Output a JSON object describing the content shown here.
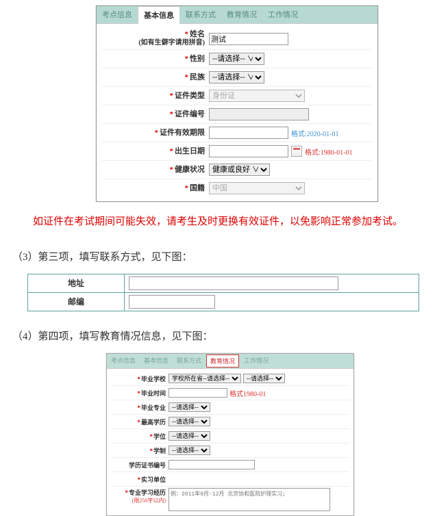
{
  "screenshot1": {
    "tabs": [
      "考点信息",
      "基本信息",
      "联系方式",
      "教育情况",
      "工作情况"
    ],
    "activeTabIndex": 1,
    "rows": {
      "name": {
        "label": "姓名",
        "sublabel": "(如有生僻字请用拼音)",
        "value": "测试"
      },
      "gender": {
        "label": "性别",
        "value": "--请选择-- ∨"
      },
      "ethnic": {
        "label": "民族",
        "value": "--请选择-- ∨"
      },
      "idtype": {
        "label": "证件类型",
        "value": "身份证"
      },
      "idnum": {
        "label": "证件编号",
        "value": ""
      },
      "idexp": {
        "label": "证件有效期限",
        "value": "",
        "hint": "格式:2020-01-01"
      },
      "birth": {
        "label": "出生日期",
        "value": "",
        "hint": "格式:1980-01-01"
      },
      "health": {
        "label": "健康状况",
        "value": "健康或良好 ∨"
      },
      "nation": {
        "label": "国籍",
        "value": "中国"
      }
    }
  },
  "warning": "　　如证件在考试期间可能失效，请考生及时更换有效证件，以免影响正常参加考试。",
  "step3": "（3）第三项，填写联系方式，见下图：",
  "screenshot2": {
    "rows": {
      "addr": {
        "label": "地址",
        "value": ""
      },
      "zip": {
        "label": "邮编",
        "value": ""
      }
    }
  },
  "step4": "（4）第四项，填写教育情况信息，见下图：",
  "screenshot3": {
    "tabs": [
      "考点信息",
      "基本信息",
      "联系方式",
      "教育情况",
      "工作情况"
    ],
    "activeTabIndex": 3,
    "rows": {
      "school": {
        "label": "毕业学校",
        "value1": "学校所在省--请选择--",
        "value2": "--请选择--"
      },
      "gradtime": {
        "label": "毕业时间",
        "value": "",
        "hint": "格式1980-01"
      },
      "major": {
        "label": "毕业专业",
        "value": "--请选择--"
      },
      "edu": {
        "label": "最高学历",
        "value": "--请选择--"
      },
      "degree": {
        "label": "学位",
        "value": "--请选择--"
      },
      "schooling": {
        "label": "学制",
        "value": "--请选择--"
      },
      "certno": {
        "label": "学历证书编号",
        "value": ""
      },
      "intern": {
        "label": "实习单位"
      },
      "history": {
        "label": "专业学习经历",
        "sublabel": "(限250字以内)",
        "placeholder": "例：2011年9月-12月 北京协和医院护理实习；"
      }
    }
  }
}
